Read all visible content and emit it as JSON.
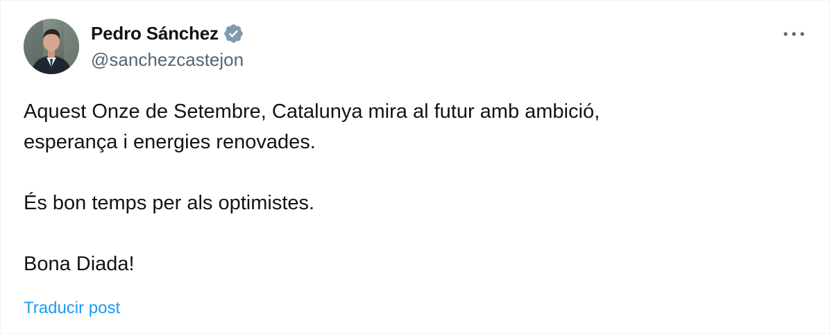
{
  "author": {
    "display_name": "Pedro Sánchez",
    "handle": "@sanchezcastejon",
    "verified_icon": "verified-badge-icon",
    "avatar_icon": "profile-photo"
  },
  "menu": {
    "more_icon": "more-options-icon"
  },
  "post": {
    "paragraphs": [
      {
        "lines": [
          "Aquest Onze de Setembre, Catalunya mira al futur amb ambició,",
          "esperança i energies renovades."
        ]
      },
      {
        "lines": [
          "És bon temps per als optimistes."
        ]
      },
      {
        "lines": [
          "Bona Diada!"
        ]
      }
    ]
  },
  "actions": {
    "translate_label": "Traducir post"
  },
  "colors": {
    "text": "#0f1419",
    "secondary": "#536471",
    "link": "#1d9bf0",
    "verified": "#829aab"
  }
}
